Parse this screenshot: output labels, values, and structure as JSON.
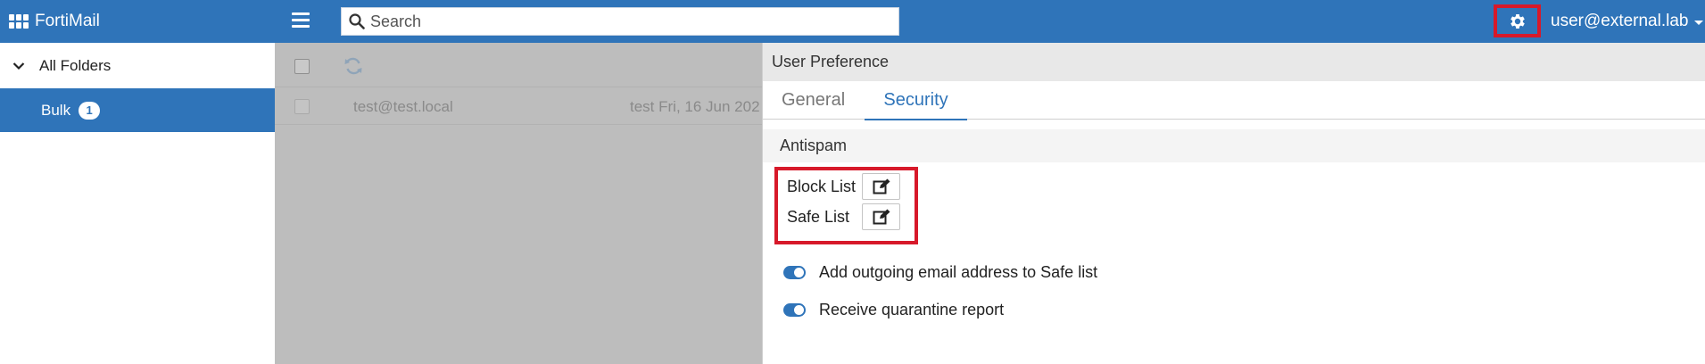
{
  "header": {
    "app_name": "FortiMail",
    "search": {
      "placeholder": "Search",
      "value": ""
    },
    "user": "user@external.lab",
    "accent": "#2f74b9",
    "highlight": "#d7192a"
  },
  "sidebar": {
    "root_label": "All Folders",
    "items": [
      {
        "label": "Bulk",
        "count": "1"
      }
    ]
  },
  "message_list": {
    "rows": [
      {
        "from": "test@test.local",
        "subject": "test Fri, 16 Jun 202"
      }
    ]
  },
  "preferences": {
    "title": "User Preference",
    "tabs": [
      {
        "label": "General",
        "active": false
      },
      {
        "label": "Security",
        "active": true
      }
    ],
    "section_title": "Antispam",
    "lists": [
      {
        "label": "Block List"
      },
      {
        "label": "Safe List"
      }
    ],
    "toggles": [
      {
        "label": "Add outgoing email address to Safe list",
        "on": true
      },
      {
        "label": "Receive quarantine report",
        "on": true
      }
    ]
  }
}
